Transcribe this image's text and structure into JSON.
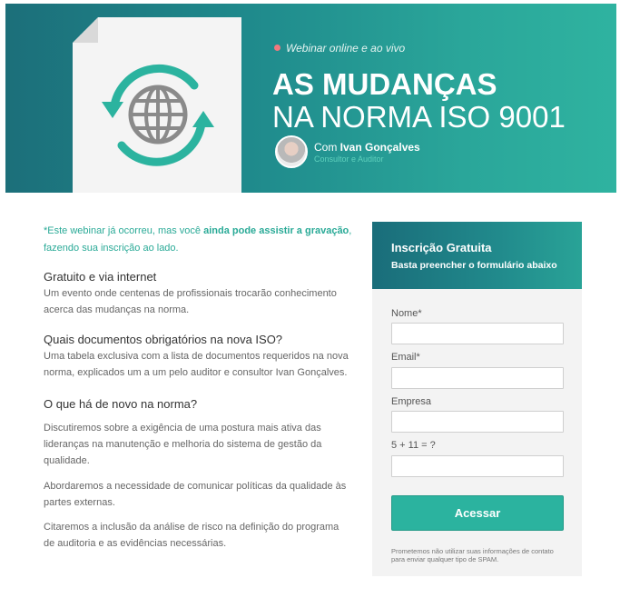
{
  "hero": {
    "tag": "Webinar online e ao vivo",
    "title_line1": "AS MUDANÇAS",
    "title_line2": "NA NORMA ISO 9001",
    "speaker_prefix": "Com ",
    "speaker_name": "Ivan Gonçalves",
    "speaker_role": "Consultor e Auditor"
  },
  "notice": {
    "part1": "*Este webinar já ocorreu, mas você ",
    "part2": "ainda pode assistir a gravação",
    "part3": ", fazendo sua inscrição ao lado."
  },
  "sections": [
    {
      "title": "Gratuito e via internet",
      "paragraphs": [
        "Um evento onde centenas de profissionais trocarão conhecimento acerca das mudanças na norma."
      ]
    },
    {
      "title": "Quais documentos obrigatórios na nova ISO?",
      "paragraphs": [
        "Uma tabela exclusiva com a lista de documentos requeridos na nova norma, explicados um a um pelo auditor e consultor Ivan Gonçalves."
      ]
    },
    {
      "title": "O que há de novo na norma?",
      "paragraphs": [
        "Discutiremos sobre a exigência de uma postura mais ativa das lideranças na manutenção e melhoria do sistema de gestão da qualidade.",
        "Abordaremos a necessidade de comunicar políticas da qualidade às partes externas.",
        "Citaremos a inclusão da análise de risco na definição do programa de auditoria e as evidências necessárias."
      ]
    }
  ],
  "form": {
    "title": "Inscrição Gratuita",
    "subtitle": "Basta preencher o formulário abaixo",
    "fields": [
      {
        "label": "Nome*",
        "value": ""
      },
      {
        "label": "Email*",
        "value": ""
      },
      {
        "label": "Empresa",
        "value": ""
      },
      {
        "label": "5 + 11 = ?",
        "value": ""
      }
    ],
    "submit_label": "Acessar",
    "note": "Prometemos não utilizar suas informações de contato para enviar qualquer tipo de SPAM."
  },
  "colors": {
    "accent": "#2bb39f",
    "hero_dark": "#1c6f7a",
    "tag_dot": "#f2787e"
  }
}
